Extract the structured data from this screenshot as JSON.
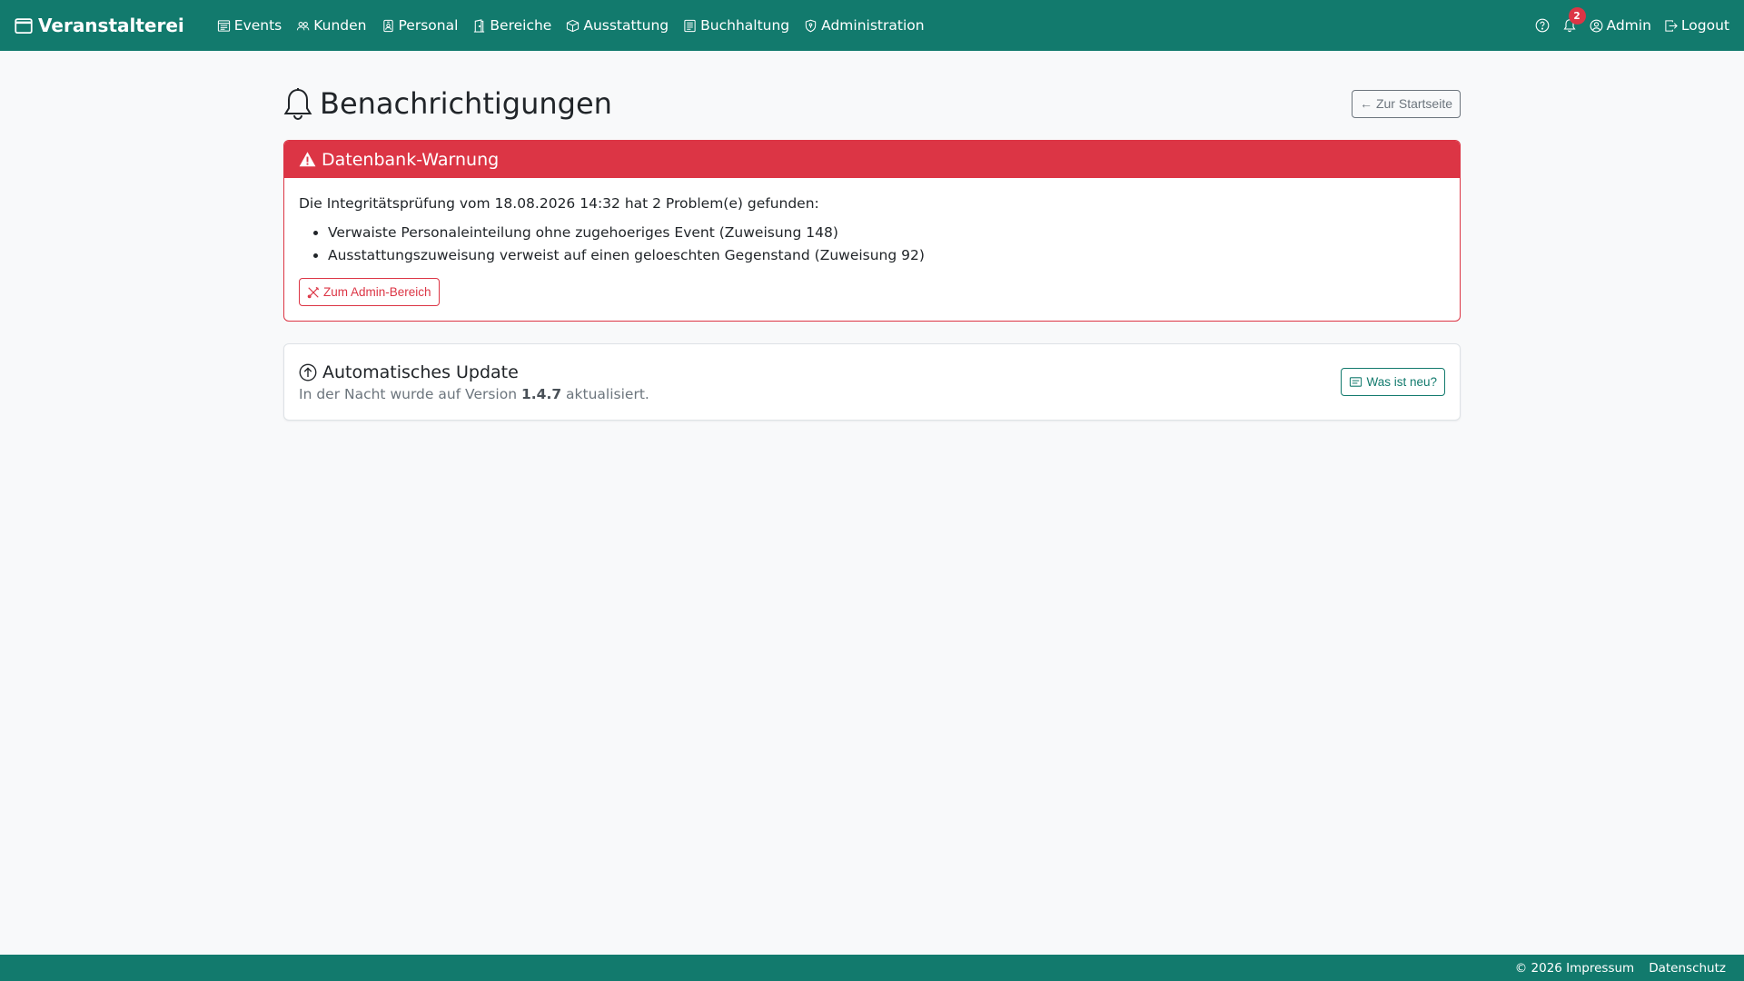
{
  "colors": {
    "primary": "#127a6d",
    "danger": "#dc3545",
    "background": "#f8f9fa"
  },
  "navbar": {
    "brand": "Veranstalterei",
    "brand_icon": "calendar-icon",
    "items": [
      {
        "label": "Events",
        "icon": "calendar-week-icon"
      },
      {
        "label": "Kunden",
        "icon": "people-icon"
      },
      {
        "label": "Personal",
        "icon": "person-badge-icon"
      },
      {
        "label": "Bereiche",
        "icon": "door-icon"
      },
      {
        "label": "Ausstattung",
        "icon": "box-icon"
      },
      {
        "label": "Buchhaltung",
        "icon": "ledger-icon"
      },
      {
        "label": "Administration",
        "icon": "shield-icon"
      }
    ],
    "help_icon": "question-circle-icon",
    "notification_count": "2",
    "user_label": "Admin",
    "logout_label": "Logout"
  },
  "page": {
    "title": "Benachrichtigungen",
    "back_button": "Zur Startseite"
  },
  "warning": {
    "title": "Datenbank-Warnung",
    "text": "Die Integritätsprüfung vom 18.08.2026 14:32 hat 2 Problem(e) gefunden:",
    "problems": [
      "Verwaiste Personaleinteilung ohne zugehoeriges Event (Zuweisung 148)",
      "Ausstattungszuweisung verweist auf einen geloeschten Gegenstand (Zuweisung 92)"
    ],
    "button": "Zum Admin-Bereich"
  },
  "update": {
    "title": "Automatisches Update",
    "text_before": "In der Nacht wurde auf Version ",
    "version": "1.4.7",
    "text_after": " aktualisiert.",
    "button": "Was ist neu?"
  },
  "footer": {
    "copyright": "© 2026 Impressum",
    "privacy": "Datenschutz"
  }
}
